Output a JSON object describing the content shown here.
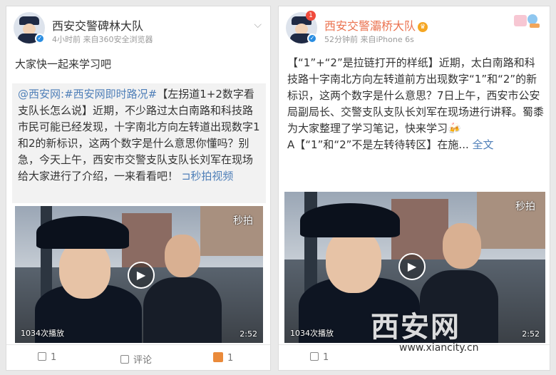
{
  "left_post": {
    "account_name": "西安交警碑林大队",
    "meta": "4小时前  来自360安全浏览器",
    "text": "大家快一起来学习吧",
    "quoted": {
      "mention": "@西安网",
      "topic": ":#西安网即时路况#",
      "body": "【左拐道1+2数字看支队长怎么说】近期，不少路过太白南路和科技路市民可能已经发现，十字南北方向左转道出现数字1和2的新标识，这两个数字是什么意思你懂吗？别急，今天上午，西安市交警支队支队长刘军在现场给大家进行了介绍，一来看看吧！",
      "video_link": "秒拍视频",
      "video_link_icon": "video-link-icon"
    },
    "video": {
      "watermark": "秒拍",
      "play_count": "1034次播放",
      "duration": "2:52"
    },
    "actions": {
      "repost": "1",
      "comment": "评论",
      "like": "1"
    }
  },
  "right_post": {
    "account_name": "西安交警灞桥大队",
    "notification_count": "1",
    "meta": "52分钟前  来自iPhone 6s",
    "text": "【“1”+“2”是拉链打开的样纸】近期，太白南路和科技路十字南北方向左转道前方出现数字“1”和“2”的新标识，这两个数字是什么意思？7日上午，西安市公安局副局长、交警支队支队长刘军在现场进行讲释。蜀黍为大家整理了学习笔记，快来学习",
    "text2": "A【“1”和“2”不是左转待转区】在施...",
    "expand_link": "全文",
    "video": {
      "watermark": "秒拍",
      "play_count": "1034次播放",
      "duration": "2:52"
    },
    "actions": {
      "repost": "1"
    }
  },
  "watermark": {
    "site_name": "西安网",
    "url": "www.xiancity.cn"
  },
  "colors": {
    "link_blue": "#4f7fb8",
    "orange_name": "#eb7350",
    "like_orange": "#ea8a3a"
  }
}
